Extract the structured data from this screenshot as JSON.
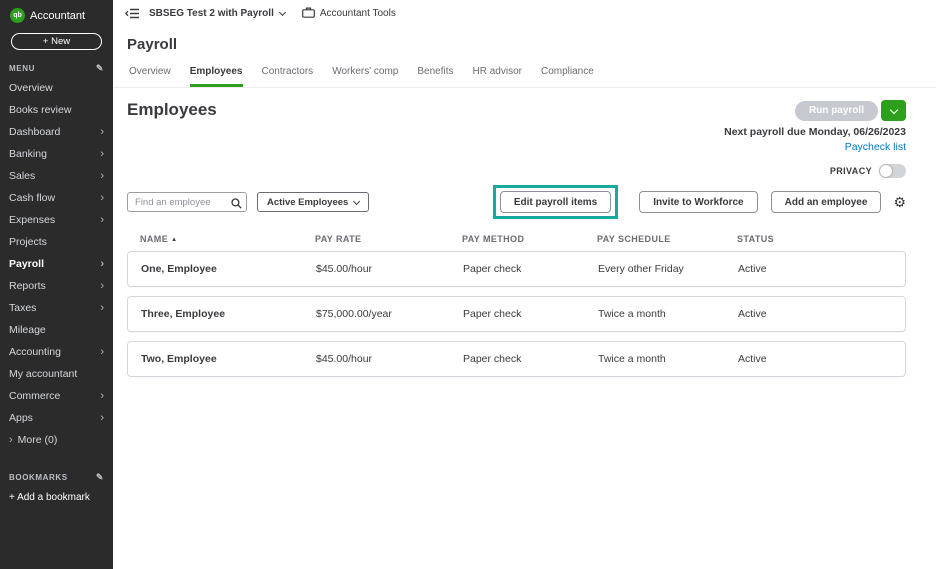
{
  "colors": {
    "brand_green": "#2ca01c",
    "link_blue": "#0077c5",
    "sidebar_bg": "#2b2b2b",
    "text_dark": "#393a3d",
    "text_gray": "#6b6c72",
    "annotation_teal": "#17a9a0",
    "disabled_pill": "#c6cad0",
    "border_gray": "#d4d7dc"
  },
  "icons": {
    "logo_badge": "qb",
    "pencil": "✎",
    "gear": "⚙",
    "sort_ascending": "▲",
    "chevron_right": "›",
    "search": "magnifier-shape",
    "briefcase": "briefcase-shape",
    "collapse_sidebar": "hamburger-with-left-arrow"
  },
  "sidebar": {
    "logo_badge": "qb",
    "logo_text": "Accountant",
    "new_button": "+ New",
    "menu_label": "MENU",
    "items": [
      "Overview",
      "Books review",
      "Dashboard",
      "Banking",
      "Sales",
      "Cash flow",
      "Expenses",
      "Projects",
      "Payroll",
      "Reports",
      "Taxes",
      "Mileage",
      "Accounting",
      "My accountant",
      "Commerce",
      "Apps",
      "More (0)"
    ],
    "bookmarks_label": "BOOKMARKS",
    "add_bookmark": "+ Add a bookmark"
  },
  "topbar": {
    "company_name": "SBSEG Test 2 with Payroll",
    "accountant_tools": "Accountant Tools"
  },
  "page": {
    "title": "Payroll",
    "tabs": [
      "Overview",
      "Employees",
      "Contractors",
      "Workers' comp",
      "Benefits",
      "HR advisor",
      "Compliance"
    ],
    "active_tab": "Employees",
    "section_title": "Employees",
    "run_payroll_label": "Run payroll",
    "next_payroll_due": "Next payroll due Monday, 06/26/2023",
    "paycheck_list_link": "Paycheck list",
    "privacy_label": "PRIVACY",
    "privacy_toggle_state": "off"
  },
  "controls": {
    "search_placeholder": "Find an employee",
    "filter_selected": "Active Employees",
    "edit_payroll_items": "Edit payroll items",
    "invite_to_workforce": "Invite to Workforce",
    "add_an_employee": "Add an employee"
  },
  "table": {
    "headers": {
      "name": "NAME",
      "pay_rate": "PAY RATE",
      "pay_method": "PAY METHOD",
      "pay_schedule": "PAY SCHEDULE",
      "status": "STATUS"
    },
    "sort_column": "NAME",
    "sort_direction": "ascending",
    "rows": [
      {
        "name": "One, Employee",
        "pay_rate": "$45.00/hour",
        "pay_method": "Paper check",
        "pay_schedule": "Every other Friday",
        "status": "Active"
      },
      {
        "name": "Three, Employee",
        "pay_rate": "$75,000.00/year",
        "pay_method": "Paper check",
        "pay_schedule": "Twice a month",
        "status": "Active"
      },
      {
        "name": "Two, Employee",
        "pay_rate": "$45.00/hour",
        "pay_method": "Paper check",
        "pay_schedule": "Twice a month",
        "status": "Active"
      }
    ]
  }
}
